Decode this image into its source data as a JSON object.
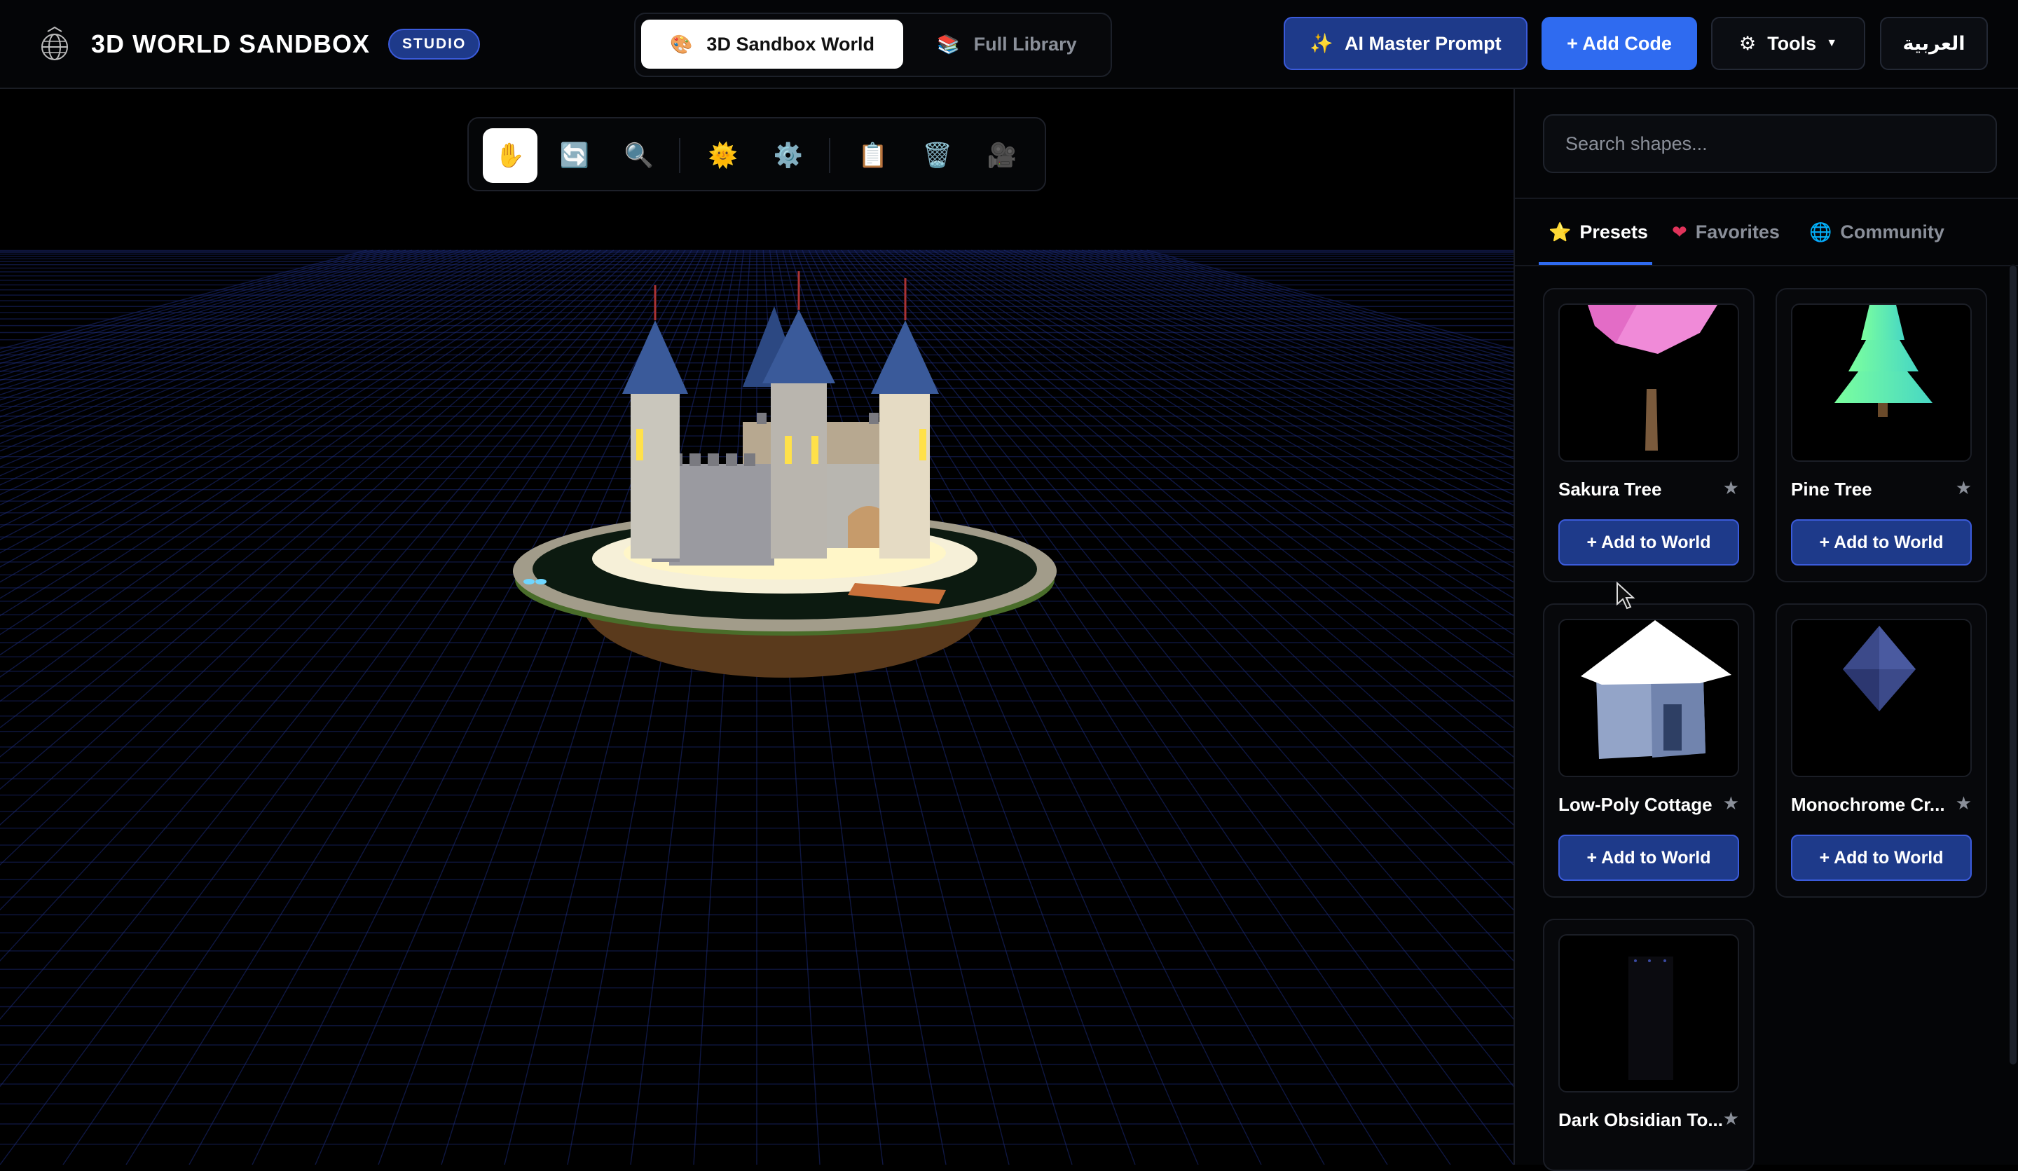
{
  "header": {
    "brand_title": "3D WORLD SANDBOX",
    "badge": "STUDIO",
    "tabs": [
      {
        "label": "3D Sandbox World",
        "icon": "easel-icon",
        "active": true
      },
      {
        "label": "Full Library",
        "icon": "books-icon",
        "active": false
      }
    ],
    "ai_button": "AI Master Prompt",
    "add_code_button": "+ Add Code",
    "tools_button": "Tools",
    "language_button": "العربية"
  },
  "toolbar": {
    "tools": [
      {
        "name": "pan-hand-icon",
        "glyph": "✋",
        "active": true
      },
      {
        "name": "rotate-icon",
        "glyph": "🔄"
      },
      {
        "name": "zoom-icon",
        "glyph": "🔍"
      },
      {
        "name": "sun-light-icon",
        "glyph": "🌞"
      },
      {
        "name": "settings-gear-icon",
        "glyph": "⚙️"
      },
      {
        "name": "clipboard-icon",
        "glyph": "📋"
      },
      {
        "name": "trash-icon",
        "glyph": "🗑️"
      },
      {
        "name": "camera-icon",
        "glyph": "🎥"
      }
    ]
  },
  "sidebar": {
    "search_placeholder": "Search shapes...",
    "tabs": [
      {
        "label": "Presets",
        "icon": "star-icon",
        "active": true
      },
      {
        "label": "Favorites",
        "icon": "heart-icon"
      },
      {
        "label": "Community",
        "icon": "globe-icon"
      }
    ],
    "add_label": "+ Add to World",
    "cards": [
      {
        "name": "Sakura Tree",
        "thumb": "sakura"
      },
      {
        "name": "Pine Tree",
        "thumb": "pine"
      },
      {
        "name": "Low-Poly Cottage",
        "thumb": "cottage"
      },
      {
        "name": "Monochrome Cr...",
        "thumb": "crystal"
      },
      {
        "name": "Dark Obsidian To...",
        "thumb": "obsidian"
      }
    ]
  },
  "colors": {
    "accent": "#2f6bf0",
    "accent_dark": "#1e3a8a",
    "background": "#000000",
    "grid_line": "#1c2b78"
  }
}
